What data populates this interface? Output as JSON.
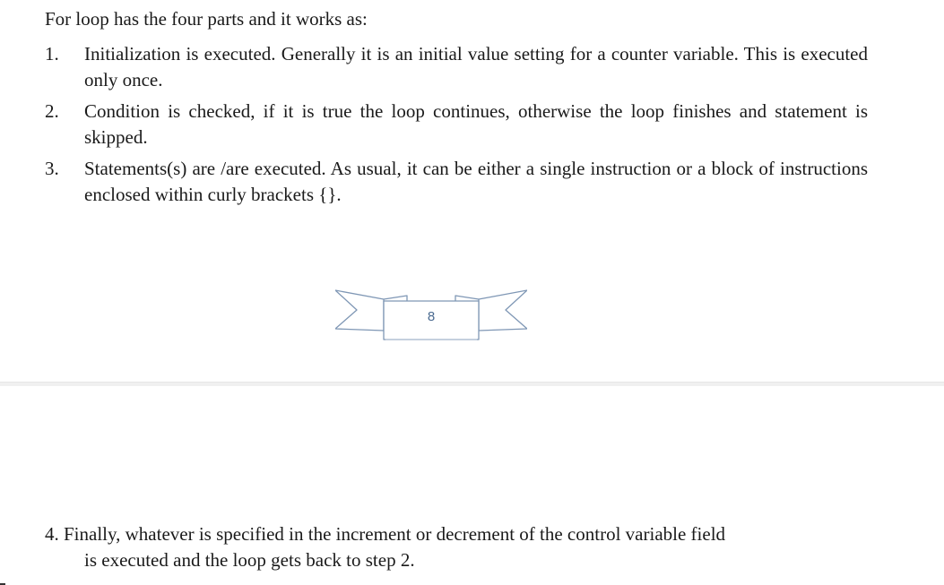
{
  "document": {
    "intro": "For loop has the four parts and it works as:",
    "items": [
      {
        "number": "1.",
        "text": "Initialization is executed. Generally it is an initial value setting for a counter variable. This is executed only once."
      },
      {
        "number": "2.",
        "text": "Condition is checked, if it is true the loop continues, otherwise the loop finishes and statement is skipped."
      },
      {
        "number": "3.",
        "text": "Statements(s) are /are executed. As usual, it can be either a single instruction or a block of instructions enclosed within curly brackets {}."
      }
    ],
    "item4": {
      "line1": "4. Finally, whatever is specified in the increment or decrement of the control variable field",
      "line2": "is executed and the loop gets back to step 2."
    }
  },
  "footer": {
    "page_number": "8",
    "ornament_icon": "ribbon-banner-icon",
    "ornament_color": "#7f97b5"
  },
  "page_break_color": "#f0f0f0"
}
